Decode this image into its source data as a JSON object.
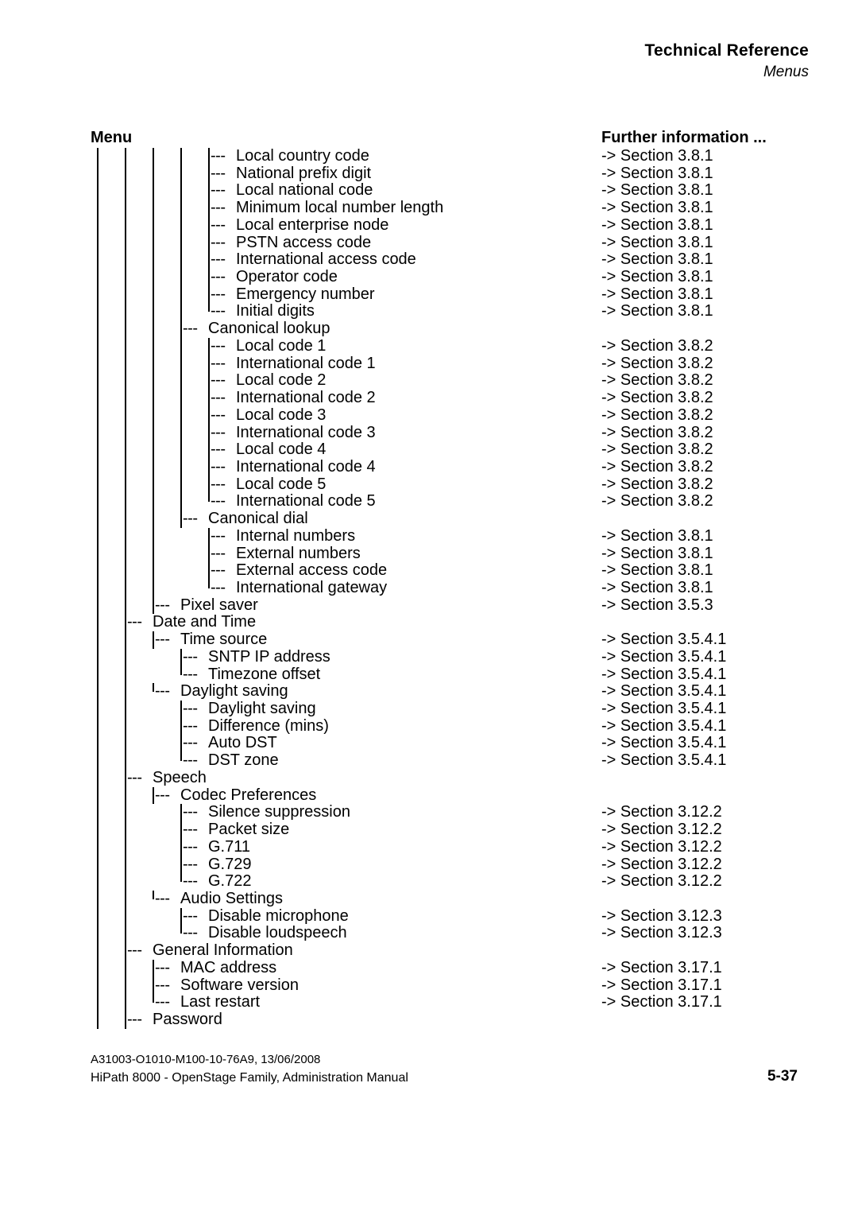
{
  "header": {
    "title": "Technical Reference",
    "subtitle": "Menus"
  },
  "columns": {
    "menu_heading": "Menu",
    "further_heading": "Further information ..."
  },
  "dash_glyph": "---",
  "tree": {
    "rows": [
      {
        "level": 5,
        "label": "Local country code",
        "ref": "-> Section 3.8.1",
        "last": false
      },
      {
        "level": 5,
        "label": "National prefix digit",
        "ref": "-> Section 3.8.1",
        "last": false
      },
      {
        "level": 5,
        "label": "Local national code",
        "ref": "-> Section 3.8.1",
        "last": false
      },
      {
        "level": 5,
        "label": "Minimum local number length",
        "ref": "-> Section 3.8.1",
        "last": false
      },
      {
        "level": 5,
        "label": "Local enterprise node",
        "ref": "-> Section 3.8.1",
        "last": false
      },
      {
        "level": 5,
        "label": "PSTN access code",
        "ref": "-> Section 3.8.1",
        "last": false
      },
      {
        "level": 5,
        "label": "International access code",
        "ref": "-> Section 3.8.1",
        "last": false
      },
      {
        "level": 5,
        "label": "Operator code",
        "ref": "-> Section 3.8.1",
        "last": false
      },
      {
        "level": 5,
        "label": "Emergency number",
        "ref": "-> Section 3.8.1",
        "last": false
      },
      {
        "level": 5,
        "label": "Initial digits",
        "ref": "-> Section 3.8.1",
        "last": true
      },
      {
        "level": 4,
        "label": "Canonical lookup",
        "ref": "",
        "last": false
      },
      {
        "level": 5,
        "label": "Local code 1",
        "ref": "-> Section 3.8.2",
        "last": false
      },
      {
        "level": 5,
        "label": "International code 1",
        "ref": "-> Section 3.8.2",
        "last": false
      },
      {
        "level": 5,
        "label": "Local code 2",
        "ref": "-> Section 3.8.2",
        "last": false
      },
      {
        "level": 5,
        "label": "International code 2",
        "ref": "-> Section 3.8.2",
        "last": false
      },
      {
        "level": 5,
        "label": "Local code 3",
        "ref": "-> Section 3.8.2",
        "last": false
      },
      {
        "level": 5,
        "label": "International code 3",
        "ref": "-> Section 3.8.2",
        "last": false
      },
      {
        "level": 5,
        "label": "Local code 4",
        "ref": "-> Section 3.8.2",
        "last": false
      },
      {
        "level": 5,
        "label": "International code 4",
        "ref": "-> Section 3.8.2",
        "last": false
      },
      {
        "level": 5,
        "label": "Local code 5",
        "ref": "-> Section 3.8.2",
        "last": false
      },
      {
        "level": 5,
        "label": "International code 5",
        "ref": "-> Section 3.8.2",
        "last": true
      },
      {
        "level": 4,
        "label": "Canonical dial",
        "ref": "",
        "last": true
      },
      {
        "level": 5,
        "label": "Internal numbers",
        "ref": "-> Section 3.8.1",
        "last": false
      },
      {
        "level": 5,
        "label": "External numbers",
        "ref": "-> Section 3.8.1",
        "last": false
      },
      {
        "level": 5,
        "label": "External access code",
        "ref": "-> Section 3.8.1",
        "last": false
      },
      {
        "level": 5,
        "label": "International gateway",
        "ref": "-> Section 3.8.1",
        "last": true
      },
      {
        "level": 3,
        "label": "Pixel saver",
        "ref": "-> Section 3.5.3",
        "last": true
      },
      {
        "level": 2,
        "label": "Date and Time",
        "ref": "",
        "last": false
      },
      {
        "level": 3,
        "label": "Time source",
        "ref": "-> Section 3.5.4.1",
        "last": false
      },
      {
        "level": 4,
        "label": "SNTP IP address",
        "ref": "-> Section 3.5.4.1",
        "last": false
      },
      {
        "level": 4,
        "label": "Timezone offset",
        "ref": "-> Section 3.5.4.1",
        "last": true
      },
      {
        "level": 3,
        "label": "Daylight saving",
        "ref": "-> Section 3.5.4.1",
        "last": true
      },
      {
        "level": 4,
        "label": "Daylight saving",
        "ref": "-> Section 3.5.4.1",
        "last": false
      },
      {
        "level": 4,
        "label": "Difference (mins)",
        "ref": "-> Section 3.5.4.1",
        "last": false
      },
      {
        "level": 4,
        "label": "Auto DST",
        "ref": "-> Section 3.5.4.1",
        "last": false
      },
      {
        "level": 4,
        "label": "DST zone",
        "ref": "-> Section 3.5.4.1",
        "last": true
      },
      {
        "level": 2,
        "label": "Speech",
        "ref": "",
        "last": false
      },
      {
        "level": 3,
        "label": "Codec Preferences",
        "ref": "",
        "last": false
      },
      {
        "level": 4,
        "label": "Silence suppression",
        "ref": "-> Section 3.12.2",
        "last": false
      },
      {
        "level": 4,
        "label": "Packet size",
        "ref": "-> Section 3.12.2",
        "last": false
      },
      {
        "level": 4,
        "label": "G.711",
        "ref": "-> Section 3.12.2",
        "last": false
      },
      {
        "level": 4,
        "label": "G.729",
        "ref": "-> Section 3.12.2",
        "last": false
      },
      {
        "level": 4,
        "label": "G.722",
        "ref": "-> Section 3.12.2",
        "last": true
      },
      {
        "level": 3,
        "label": "Audio Settings",
        "ref": "",
        "last": true
      },
      {
        "level": 4,
        "label": "Disable microphone",
        "ref": "-> Section 3.12.3",
        "last": false
      },
      {
        "level": 4,
        "label": "Disable loudspeech",
        "ref": "-> Section 3.12.3",
        "last": true
      },
      {
        "level": 2,
        "label": "General Information",
        "ref": "",
        "last": false
      },
      {
        "level": 3,
        "label": "MAC address",
        "ref": "-> Section 3.17.1",
        "last": false
      },
      {
        "level": 3,
        "label": "Software version",
        "ref": "-> Section 3.17.1",
        "last": false
      },
      {
        "level": 3,
        "label": "Last restart",
        "ref": "-> Section 3.17.1",
        "last": true
      },
      {
        "level": 2,
        "label": "Password",
        "ref": "",
        "last": true
      }
    ],
    "rails": [
      {
        "level": 1,
        "from_row": 0,
        "to_row": 50
      },
      {
        "level": 2,
        "from_row": 0,
        "to_row": 50
      },
      {
        "level": 3,
        "from_row": 0,
        "to_row": 26
      },
      {
        "level": 4,
        "from_row": 0,
        "to_row": 21
      }
    ]
  },
  "footer": {
    "line1": "A31003-O1010-M100-10-76A9, 13/06/2008",
    "line2": "HiPath 8000 - OpenStage Family, Administration Manual",
    "page": "5-37"
  }
}
